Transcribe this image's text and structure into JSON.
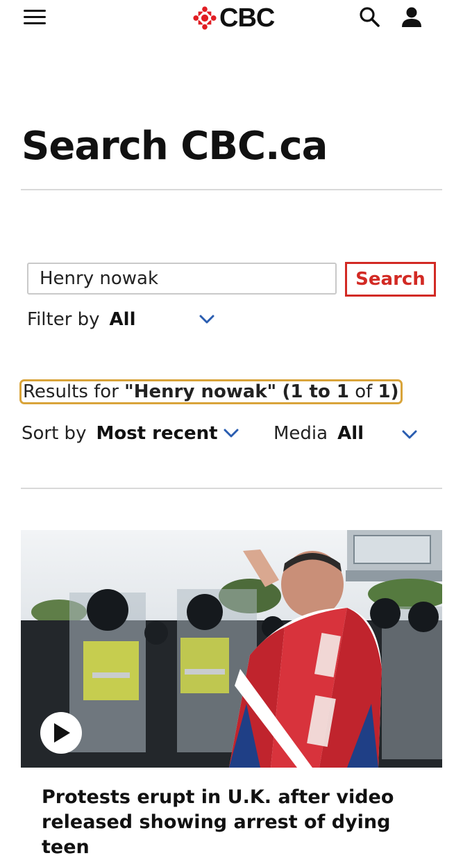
{
  "header": {
    "logo_text": "CBC",
    "menu_icon": "hamburger-menu-icon",
    "search_icon": "search-icon",
    "account_icon": "account-icon",
    "brand_color": "#e11d23"
  },
  "page": {
    "title": "Search CBC.ca"
  },
  "search": {
    "value": "Henry nowak",
    "button_label": "Search",
    "button_color": "#d22a24"
  },
  "filter": {
    "label": "Filter by",
    "selected": "All"
  },
  "results": {
    "prefix": "Results for ",
    "query": "\"Henry nowak\"",
    "range_open": "(1 to 1",
    "of_text": " of ",
    "total_close": "1)"
  },
  "sort": {
    "label": "Sort by",
    "selected": "Most recent"
  },
  "media": {
    "label": "Media",
    "selected": "All"
  },
  "article": {
    "headline": "Protests erupt in U.K. after video released showing arrest of dying teen",
    "play_icon": "play-icon",
    "accent_color": "#2a5db0"
  }
}
